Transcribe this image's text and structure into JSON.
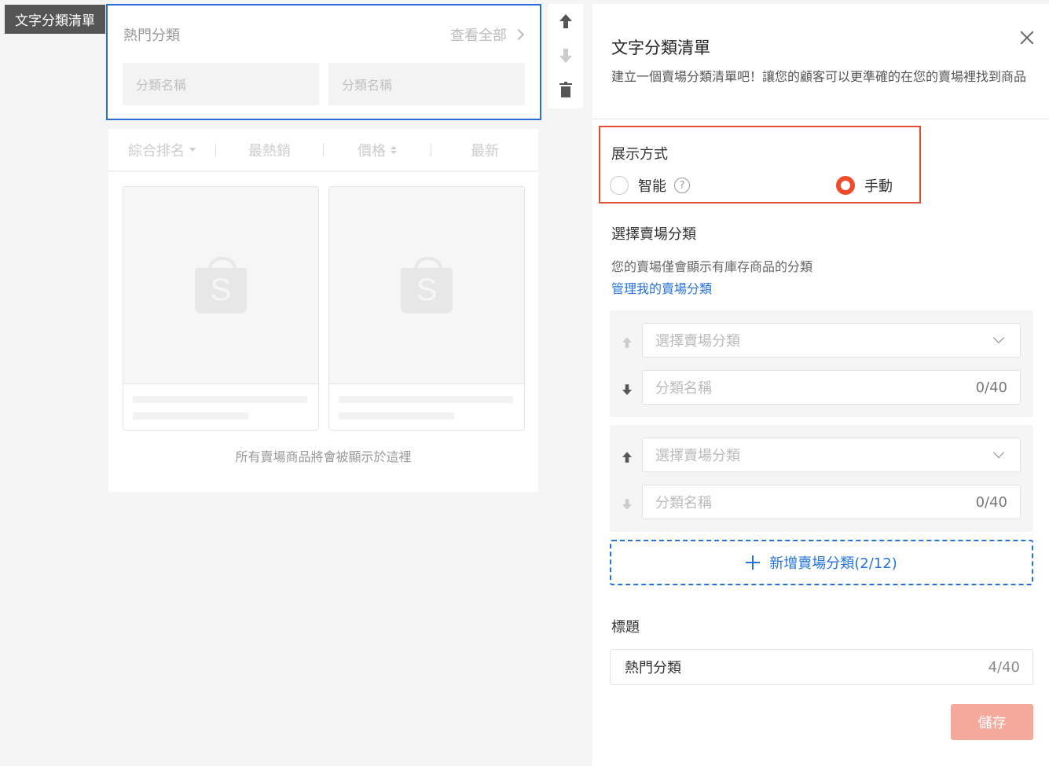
{
  "widget_tag": "文字分類清單",
  "preview": {
    "header_title": "熱門分類",
    "view_all": "查看全部",
    "chips": [
      "分類名稱",
      "分類名稱"
    ],
    "sort": [
      "綜合排名",
      "最熱銷",
      "價格",
      "最新"
    ],
    "footer_note": "所有賣場商品將會被顯示於這裡"
  },
  "panel": {
    "title": "文字分類清單",
    "description": "建立一個賣場分類清單吧！讓您的顧客可以更準確的在您的賣場裡找到商品",
    "display_mode": {
      "label": "展示方式",
      "options": [
        "智能",
        "手動"
      ],
      "selected": "手動"
    },
    "select_category": {
      "label": "選擇賣場分類",
      "hint": "您的賣場僅會顯示有庫存商品的分類",
      "manage_link": "管理我的賣場分類"
    },
    "categories": [
      {
        "select_placeholder": "選擇賣場分類",
        "name_placeholder": "分類名稱",
        "count": "0/40"
      },
      {
        "select_placeholder": "選擇賣場分類",
        "name_placeholder": "分類名稱",
        "count": "0/40"
      }
    ],
    "add_button": "新增賣場分類(2/12)",
    "title_label": "標題",
    "title_value": "熱門分類",
    "title_count": "4/40",
    "save_button": "儲存"
  },
  "colors": {
    "accent": "#ee4d2d",
    "link": "#2673dd",
    "selection_border": "#2b6fd6"
  }
}
